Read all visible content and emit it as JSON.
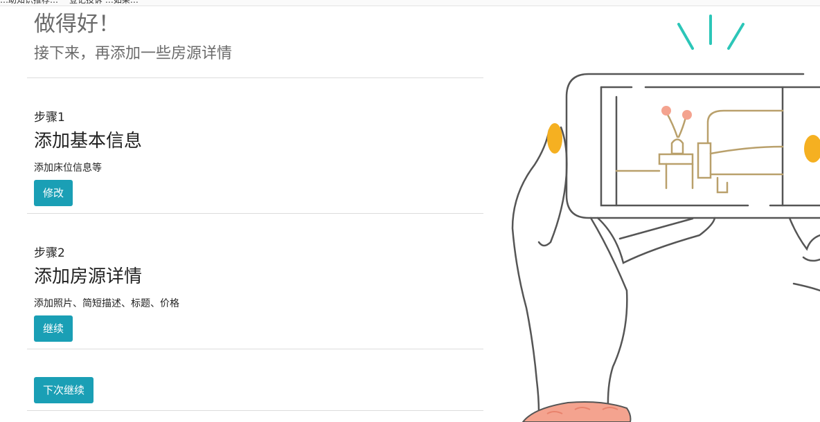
{
  "browser_bar": {
    "item1": "…助知识推荐…",
    "item2": "登记投诉 …如果…"
  },
  "header": {
    "title": "做得好！",
    "subtitle": "接下来，再添加一些房源详情"
  },
  "steps": [
    {
      "label": "步骤1",
      "title": "添加基本信息",
      "description": "添加床位信息等",
      "button": "修改"
    },
    {
      "label": "步骤2",
      "title": "添加房源详情",
      "description": "添加照片、简短描述、标题、价格",
      "button": "继续"
    }
  ],
  "footer": {
    "button": "下次继续"
  },
  "colors": {
    "accent": "#1a9fb5",
    "sparkle": "#2cc6b8",
    "nail": "#f5b021",
    "sleeve": "#f4a38f",
    "furniture": "#b9a06b"
  }
}
